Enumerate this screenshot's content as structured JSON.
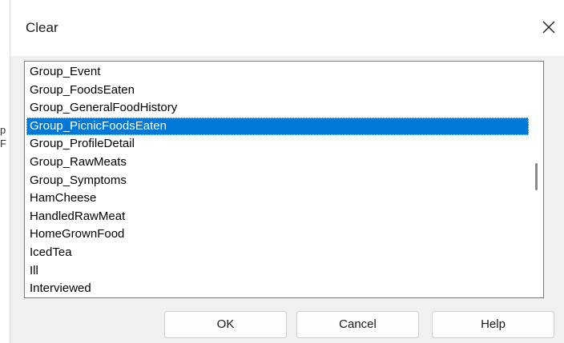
{
  "backdrop": {
    "fragments": [
      "p",
      "F"
    ]
  },
  "dialog": {
    "title": "Clear",
    "close_icon": "close-icon"
  },
  "list": {
    "items": [
      {
        "label": "Group_Event",
        "selected": false
      },
      {
        "label": "Group_FoodsEaten",
        "selected": false
      },
      {
        "label": "Group_GeneralFoodHistory",
        "selected": false
      },
      {
        "label": "Group_PicnicFoodsEaten",
        "selected": true
      },
      {
        "label": "Group_ProfileDetail",
        "selected": false
      },
      {
        "label": "Group_RawMeats",
        "selected": false
      },
      {
        "label": "Group_Symptoms",
        "selected": false
      },
      {
        "label": "HamCheese",
        "selected": false
      },
      {
        "label": "HandledRawMeat",
        "selected": false
      },
      {
        "label": "HomeGrownFood",
        "selected": false
      },
      {
        "label": "IcedTea",
        "selected": false
      },
      {
        "label": "Ill",
        "selected": false
      },
      {
        "label": "Interviewed",
        "selected": false
      }
    ]
  },
  "buttons": {
    "ok": "OK",
    "cancel": "Cancel",
    "help": "Help"
  },
  "colors": {
    "selection": "#0078d7",
    "dialog_bg": "#f0f0f0"
  }
}
